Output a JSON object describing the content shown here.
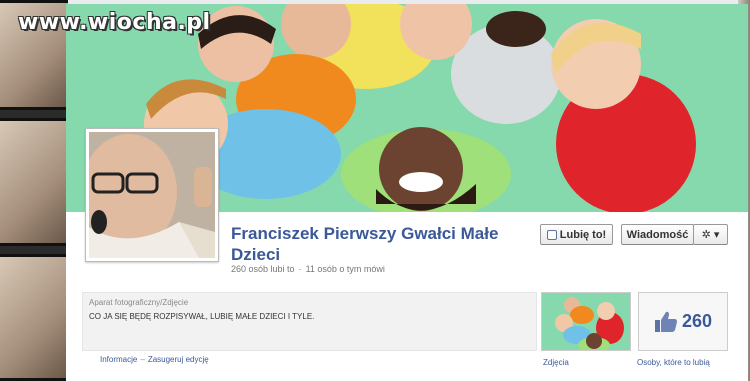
{
  "watermark": "www.wiocha.pl",
  "page": {
    "title": "Franciszek Pierwszy Gwałci Małe Dzieci",
    "likes_text": "260 osób lubi to",
    "talking_text": "11 osób o tym mówi",
    "separator": "·"
  },
  "buttons": {
    "like_label": "Lubię to!",
    "message_label": "Wiadomość",
    "gear_label": "✲ ▾"
  },
  "about": {
    "category": "Aparat fotograficzny/Zdjęcie",
    "text": "CO JA SIĘ BĘDĘ ROZPISYWAŁ, LUBIĘ MAŁE DZIECI I TYLE.",
    "link_info": "Informacje",
    "link_separator": "–",
    "link_suggest": "Zasugeruj edycję"
  },
  "tiles": {
    "photos_label": "Zdjęcia",
    "likes_count": "260",
    "likes_label": "Osoby, które to lubią"
  },
  "colors": {
    "link_blue": "#3b5998",
    "cover_green": "#8ddcb1"
  }
}
